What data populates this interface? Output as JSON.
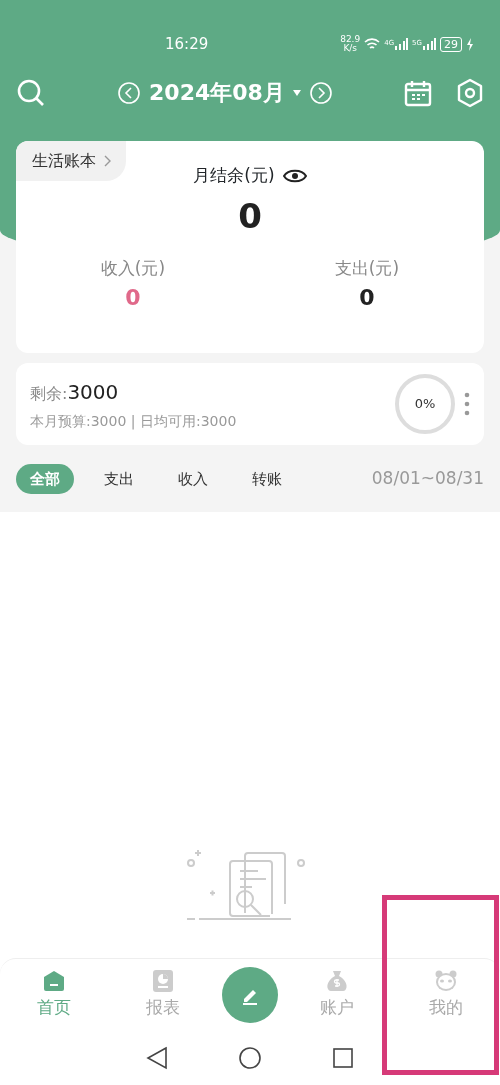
{
  "status_bar": {
    "time": "16:29",
    "speed": "82.9",
    "speed_unit": "K/s",
    "network_1": "4G",
    "network_2": "5G",
    "battery": "29"
  },
  "header": {
    "month": "2024年08月"
  },
  "summary": {
    "book": "生活账本",
    "balance_label": "月结余(元)",
    "balance": "0",
    "income_label": "收入(元)",
    "income": "0",
    "expense_label": "支出(元)",
    "expense": "0"
  },
  "budget": {
    "remaining_label": "剩余:",
    "remaining": "3000",
    "detail": "本月预算:3000 | 日均可用:3000",
    "percent": "0%",
    "level": 0
  },
  "filters": [
    {
      "label": "全部",
      "selected": true
    },
    {
      "label": "支出",
      "selected": false
    },
    {
      "label": "收入",
      "selected": false
    },
    {
      "label": "转账",
      "selected": false
    }
  ],
  "date_range": "08/01~08/31",
  "tabs": [
    {
      "label": "首页",
      "kind": "home",
      "selected": true,
      "highlighted": false
    },
    {
      "label": "报表",
      "kind": "report",
      "selected": false,
      "highlighted": false
    },
    {
      "kind": "add",
      "highlighted": false
    },
    {
      "label": "账户",
      "kind": "account",
      "selected": false,
      "highlighted": false
    },
    {
      "label": "我的",
      "kind": "me",
      "selected": false,
      "highlighted": true
    }
  ]
}
